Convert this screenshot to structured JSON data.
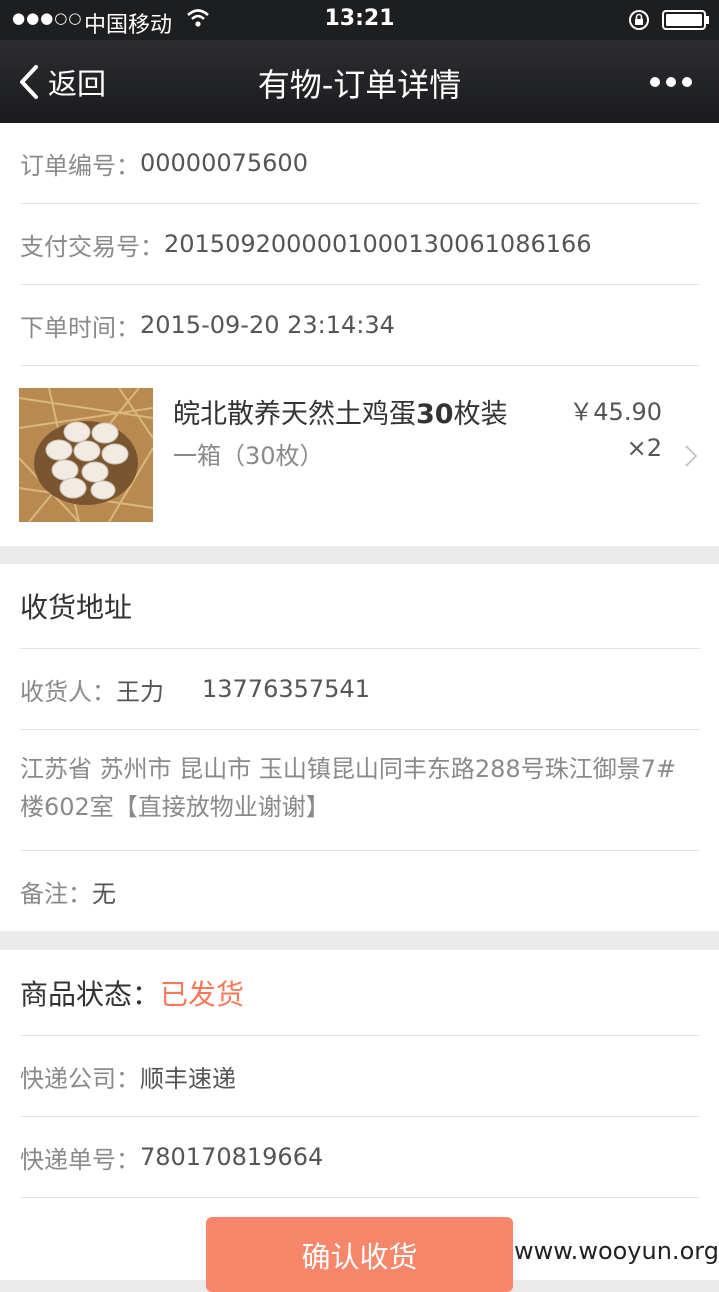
{
  "status_bar": {
    "signal": "●●●○○",
    "carrier": "中国移动",
    "time": "13:21"
  },
  "nav": {
    "back_label": "返回",
    "title": "有物-订单详情"
  },
  "order": {
    "number_label": "订单编号：",
    "number": "00000075600",
    "payment_label": "支付交易号：",
    "payment_no": "2015092000001000130061086166",
    "time_label": "下单时间：",
    "time": "2015-09-20 23:14:34"
  },
  "product": {
    "name_prefix": "皖北散养天然土鸡蛋",
    "name_bold": "30",
    "name_suffix": "枚装",
    "spec": "一箱（30枚）",
    "price": "￥45.90",
    "quantity": "×2"
  },
  "shipping": {
    "section_title": "收货地址",
    "receiver_label": "收货人：",
    "receiver_name": "王力",
    "phone": "13776357541",
    "address": "江苏省 苏州市 昆山市 玉山镇昆山同丰东路288号珠江御景7#楼602室【直接放物业谢谢】",
    "note_label": "备注：",
    "note": "无"
  },
  "delivery": {
    "status_label": "商品状态：",
    "status": "已发货",
    "status_color": "#f7795b",
    "courier_label": "快递公司：",
    "courier": "顺丰速递",
    "tracking_label": "快递单号：",
    "tracking_no": "780170819664"
  },
  "actions": {
    "confirm_label": "确认收货"
  },
  "watermark": "www.wooyun.org",
  "icons": [
    "wifi-icon",
    "rotation-lock-icon",
    "battery-icon",
    "back-chevron-icon",
    "more-icon",
    "chevron-right-icon"
  ]
}
